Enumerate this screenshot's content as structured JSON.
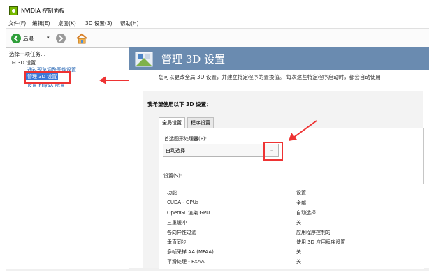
{
  "window": {
    "title": "NVIDIA 控制面板"
  },
  "menu": [
    "文件(F)",
    "编辑(E)",
    "桌面(K)",
    "3D 设置(3)",
    "帮助(H)"
  ],
  "toolbar": {
    "back_label": "后退",
    "back_dropdown": "▾"
  },
  "sidebar": {
    "title": "选择一项任务...",
    "root": "⊟ 3D 设置",
    "items": [
      "通过预览调整图像设置",
      "管理 3D 设置",
      "设置 PhysX 配置"
    ]
  },
  "main": {
    "title": "管理 3D 设置",
    "description": "您可以更改全局 3D 设置，并建立特定程序的置换值。 每次这些特定程序启动时，都会自动使用",
    "section_title": "我希望使用以下 3D 设置：",
    "tabs": [
      "全局设置",
      "程序设置"
    ],
    "gpu_label": "首选图形处理器(P):",
    "gpu_value": "自动选择",
    "settings_label": "设置(S):",
    "table": {
      "headers": [
        "功能",
        "设置"
      ],
      "rows": [
        [
          "CUDA - GPUs",
          "全部"
        ],
        [
          "OpenGL 渲染 GPU",
          "自动选择"
        ],
        [
          "三重缓冲",
          "关"
        ],
        [
          "各向异性过滤",
          "应用程序控制的"
        ],
        [
          "垂直同步",
          "使用 3D 应用程序设置"
        ],
        [
          "多帧采样 AA (MFAA)",
          "关"
        ],
        [
          "平滑处理 - FXAA",
          "关"
        ]
      ]
    }
  },
  "colors": {
    "accent_annotation": "#e33333",
    "banner": "#6a8bb0",
    "selection": "#3c78d8",
    "nvidia_green": "#76b900"
  }
}
